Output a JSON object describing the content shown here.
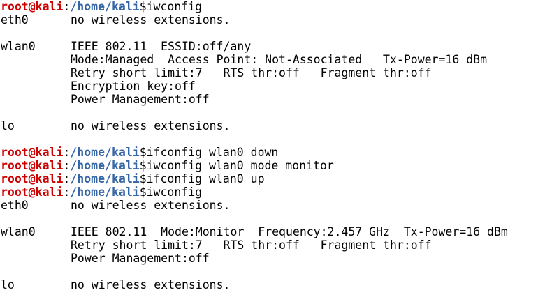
{
  "prompt": {
    "user": "root@kali",
    "colon": ":",
    "path": "/home/kali",
    "dollar": "$"
  },
  "colors": {
    "user": "#cc0000",
    "path": "#3465a4",
    "text": "#000000",
    "background": "#ffffff"
  },
  "commands": {
    "c1": "iwconfig",
    "c2": "ifconfig wlan0 down",
    "c3": "iwconfig wlan0 mode monitor",
    "c4": "ifconfig wlan0 up",
    "c5": "iwconfig"
  },
  "output1": {
    "eth0_name": "eth0",
    "eth0_text": "no wireless extensions.",
    "wlan0_name": "wlan0",
    "wlan0_l1": "IEEE 802.11  ESSID:off/any",
    "wlan0_l2": "Mode:Managed  Access Point: Not-Associated   Tx-Power=16 dBm",
    "wlan0_l3": "Retry short limit:7   RTS thr:off   Fragment thr:off",
    "wlan0_l4": "Encryption key:off",
    "wlan0_l5": "Power Management:off",
    "lo_name": "lo",
    "lo_text": "no wireless extensions."
  },
  "output2": {
    "eth0_name": "eth0",
    "eth0_text": "no wireless extensions.",
    "wlan0_name": "wlan0",
    "wlan0_l1": "IEEE 802.11  Mode:Monitor  Frequency:2.457 GHz  Tx-Power=16 dBm",
    "wlan0_l2": "Retry short limit:7   RTS thr:off   Fragment thr:off",
    "wlan0_l3": "Power Management:off",
    "lo_name": "lo",
    "lo_text": "no wireless extensions."
  }
}
